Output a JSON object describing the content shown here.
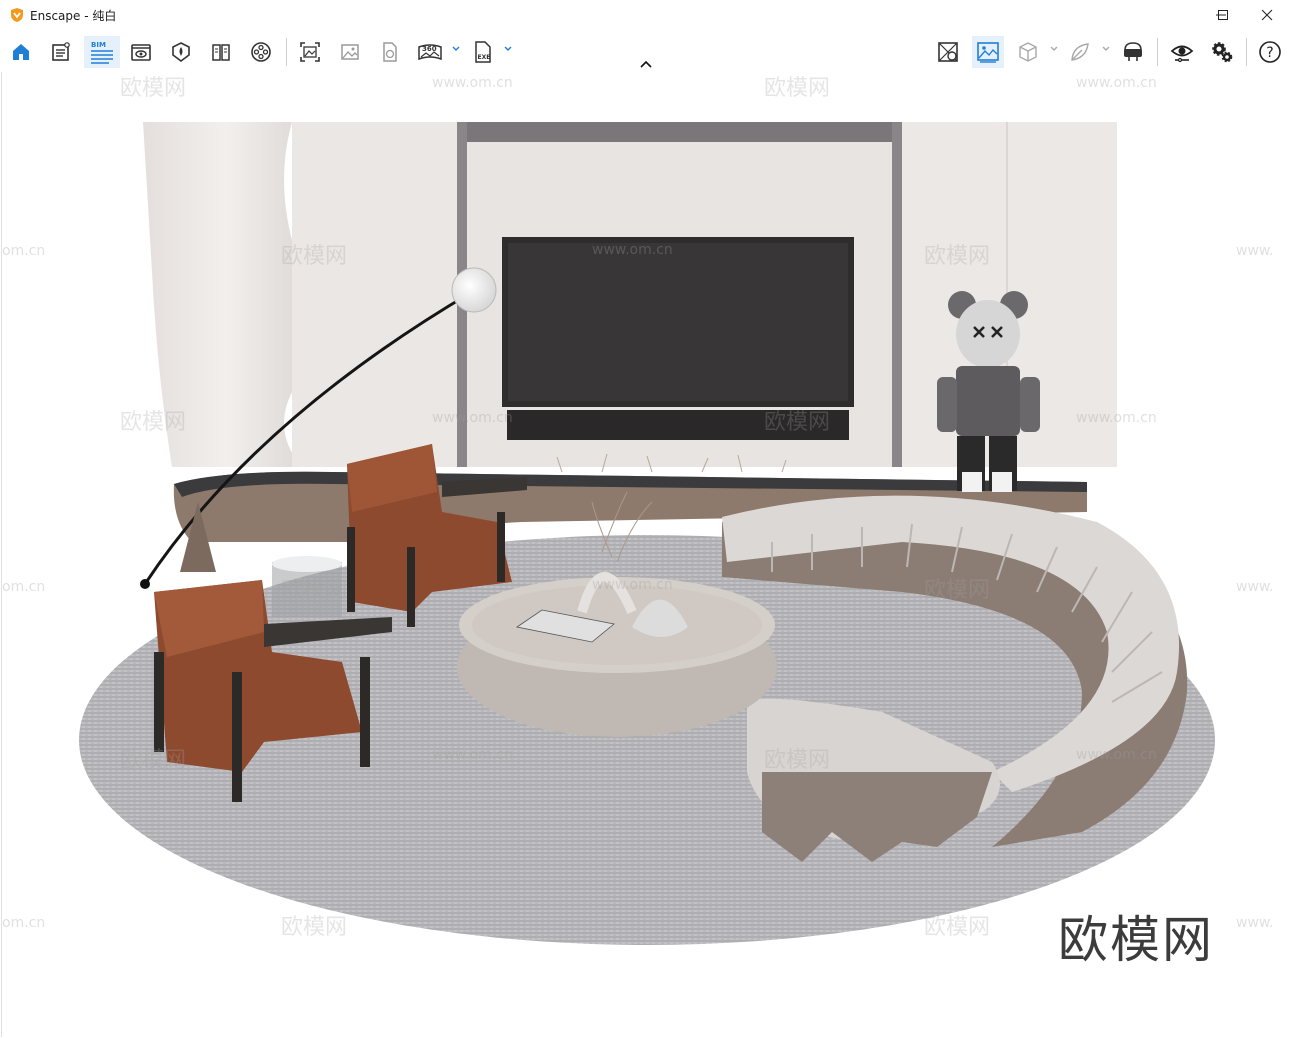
{
  "window": {
    "app_name": "Enscape",
    "title": "Enscape - 纯白"
  },
  "window_controls": {
    "minimize_icon": "minimize-icon",
    "maximize_icon": "maximize-icon",
    "close_icon": "close-icon"
  },
  "toolbar": {
    "left_icons": [
      "home-icon",
      "notes-icon",
      "bim-icon",
      "view-icon",
      "atmosphere-icon",
      "book-icon",
      "video-icon",
      "screenshot-icon",
      "image-icon",
      "panorama-export-icon",
      "panorama-360-icon",
      "exe-export-icon"
    ],
    "bim_label": "BIM",
    "pano_label": "360",
    "exe_label": "EXE",
    "right_icons": [
      "asset-library-icon",
      "visual-settings-icon",
      "cube-icon",
      "leaf-icon",
      "vr-headset-icon",
      "eye-settings-icon",
      "gear-icon",
      "help-icon"
    ],
    "help_label": "?",
    "accent": "#1f7fd8"
  },
  "viewport": {
    "watermark_main": "欧模网",
    "watermark_faint": "欧模网",
    "watermark_url": "www.om.cn",
    "watermark_url_partial": "om.cn",
    "watermark_url_partial_right": "www."
  }
}
